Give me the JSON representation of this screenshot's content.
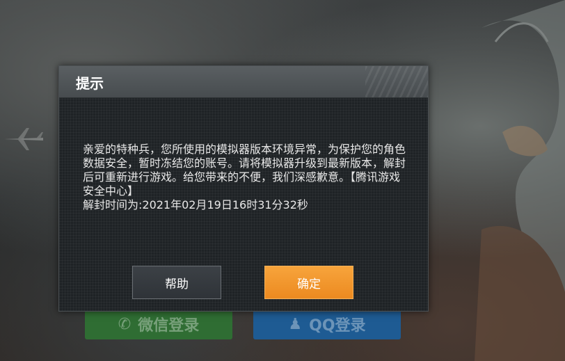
{
  "dialog": {
    "title": "提示",
    "message": "亲爱的特种兵，您所使用的模拟器版本环境异常，为保护您的角色数据安全，暂时冻结您的账号。请将模拟器升级到最新版本，解封后可重新进行游戏。给您带来的不便，我们深感歉意。【腾讯游戏安全中心】\n解封时间为:2021年02月19日16时31分32秒",
    "help_label": "帮助",
    "ok_label": "确定"
  },
  "background": {
    "wechat_login_label": "微信登录",
    "qq_login_label": "QQ登录",
    "wechat_color": "#2f6d33",
    "qq_color": "#1e5b93",
    "wechat_icon": "wechat-icon",
    "qq_icon": "qq-penguin-icon"
  },
  "colors": {
    "confirm_button": "#f39a30",
    "dialog_bg": "#1f2326",
    "header_bg": "#52575a"
  }
}
